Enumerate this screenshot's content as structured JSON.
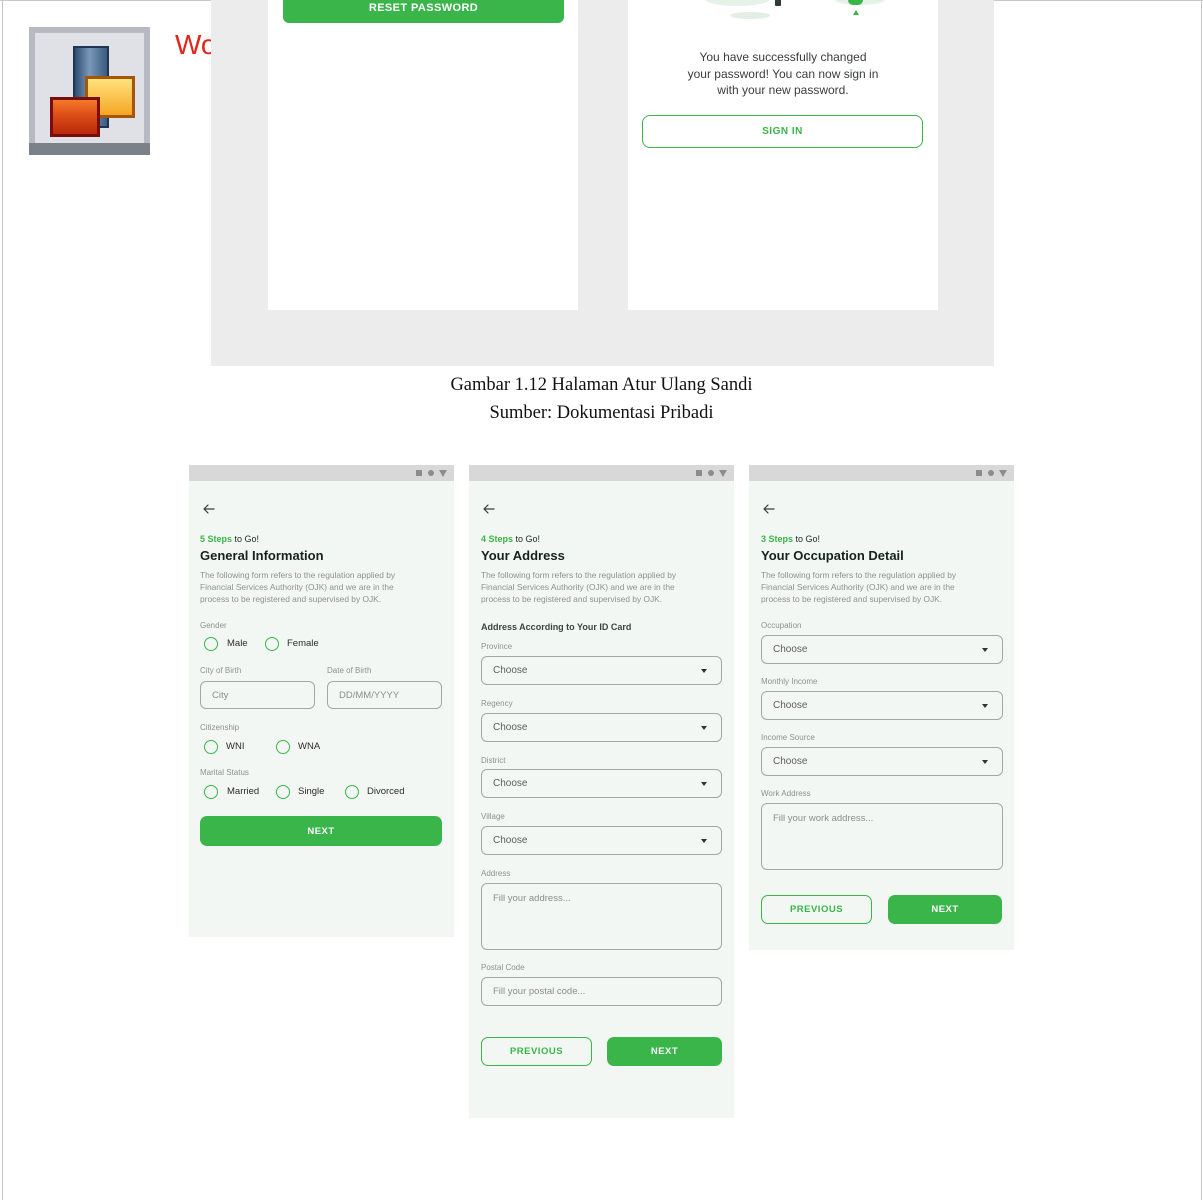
{
  "colors": {
    "accent": "#3ab54a",
    "text_dark": "#15231b",
    "text_muted": "#8d928f",
    "screen_background": "#f3f7f4",
    "figure_background": "#ececec",
    "logo_text": "#e3241b"
  },
  "page": {
    "logo_icon": "document-app-icon",
    "logo_text": "Wo"
  },
  "figure_1_12": {
    "reset_password_screen": {
      "button_label": "RESET PASSWORD"
    },
    "success_screen": {
      "illustration": "success-illustration",
      "message_lines": [
        "You have successfully changed",
        "your password! You can now sign in",
        "with your new password."
      ],
      "sign_in_label": "SIGN IN"
    },
    "caption": "Gambar 1.12 Halaman Atur Ulang Sandi",
    "source": "Sumber: Dokumentasi Pribadi"
  },
  "status_bar_icons": [
    "square-icon",
    "circle-icon",
    "triangle-down-icon"
  ],
  "screens": {
    "general_information": {
      "steps_count": "5 Steps",
      "steps_suffix": "to Go!",
      "title": "General Information",
      "description_lines": [
        "The following form refers to the regulation applied by",
        "Financial Services Authority (OJK) and we are in the",
        "process to be registered and supervised by OJK."
      ],
      "gender": {
        "label": "Gender",
        "options": [
          "Male",
          "Female"
        ]
      },
      "city_of_birth": {
        "label": "City of Birth",
        "placeholder": "City"
      },
      "date_of_birth": {
        "label": "Date of Birth",
        "placeholder": "DD/MM/YYYY"
      },
      "citizenship": {
        "label": "Citizenship",
        "options": [
          "WNI",
          "WNA"
        ]
      },
      "marital_status": {
        "label": "Marital Status",
        "options": [
          "Married",
          "Single",
          "Divorced"
        ]
      },
      "next_label": "NEXT"
    },
    "address": {
      "steps_count": "4 Steps",
      "steps_suffix": "to Go!",
      "title": "Your Address",
      "description_lines": [
        "The following form refers to the regulation applied by",
        "Financial Services Authority (OJK) and we are in the",
        "process to be registered and supervised by OJK."
      ],
      "section_title": "Address According to Your ID Card",
      "province": {
        "label": "Province",
        "selected": "Choose"
      },
      "regency": {
        "label": "Regency",
        "selected": "Choose"
      },
      "district": {
        "label": "District",
        "selected": "Choose"
      },
      "village": {
        "label": "Village",
        "selected": "Choose"
      },
      "address": {
        "label": "Address",
        "placeholder": "Fill your address..."
      },
      "postal_code": {
        "label": "Postal Code",
        "placeholder": "Fill your postal code..."
      },
      "previous_label": "PREVIOUS",
      "next_label": "NEXT"
    },
    "occupation": {
      "steps_count": "3 Steps",
      "steps_suffix": "to Go!",
      "title": "Your Occupation Detail",
      "description_lines": [
        "The following form refers to the regulation applied by",
        "Financial Services Authority (OJK) and we are in the",
        "process to be registered and supervised by OJK."
      ],
      "occupation": {
        "label": "Occupation",
        "selected": "Choose"
      },
      "monthly_income": {
        "label": "Monthly Income",
        "selected": "Choose"
      },
      "income_source": {
        "label": "Income Source",
        "selected": "Choose"
      },
      "work_address": {
        "label": "Work Address",
        "placeholder": "Fill your work address..."
      },
      "previous_label": "PREVIOUS",
      "next_label": "NEXT"
    }
  }
}
